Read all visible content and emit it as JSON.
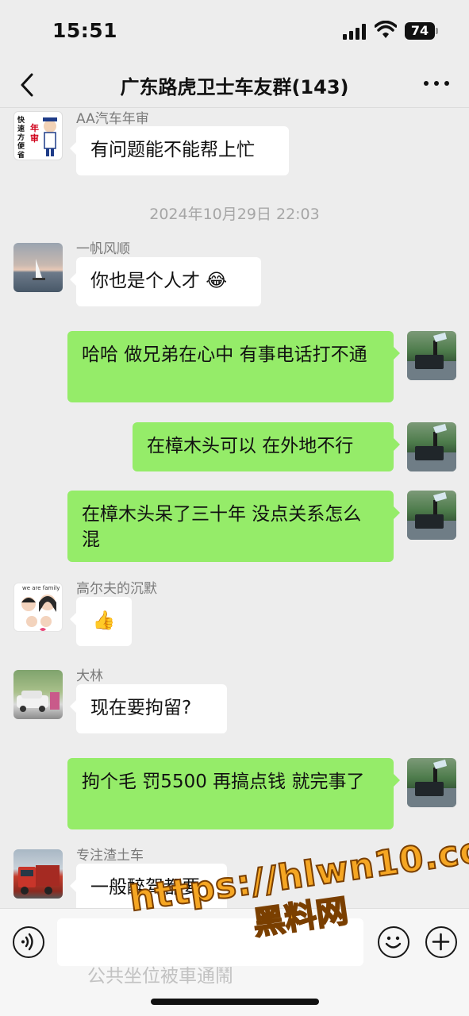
{
  "status_bar": {
    "time": "15:51",
    "battery": "74"
  },
  "nav": {
    "title": "广东路虎卫士车友群(143)"
  },
  "timestamp": "2024年10月29日 22:03",
  "avatars": {
    "shop_text": "快速方便省钱",
    "shop_badge": "年审",
    "family_text": "we are family"
  },
  "messages": [
    {
      "sender": "AA汽车年审",
      "text": "有问题能不能帮上忙"
    },
    {
      "sender": "一帆风顺",
      "text": "你也是个人才 😂"
    },
    {
      "text": "哈哈  做兄弟在心中  有事电话打不通"
    },
    {
      "text": "在樟木头可以  在外地不行"
    },
    {
      "text": "在樟木头呆了三十年  没点关系怎么混"
    },
    {
      "sender": "高尔夫的沉默",
      "text": "👍"
    },
    {
      "sender": "大林",
      "text": "现在要拘留?"
    },
    {
      "text": "拘个毛  罚5500  再搞点钱  就完事了"
    },
    {
      "sender": "专注渣土车",
      "text": "一般醉驾都要"
    }
  ],
  "input": {
    "ghost_text": "公共坐位被車通鬧"
  },
  "watermark": {
    "url": "https://hlwn10.com",
    "text": "黑料网"
  }
}
